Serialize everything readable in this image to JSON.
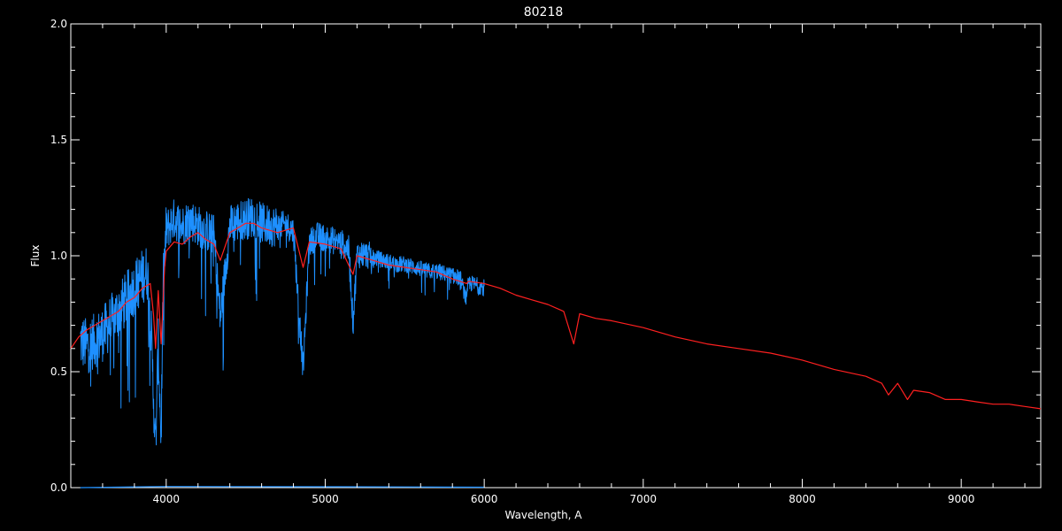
{
  "chart_data": {
    "type": "line",
    "title": "80218",
    "xlabel": "Wavelength, A",
    "ylabel": "Flux",
    "xlim": [
      3400,
      9500
    ],
    "ylim": [
      0.0,
      2.0
    ],
    "x_ticks": [
      4000,
      5000,
      6000,
      7000,
      8000,
      9000
    ],
    "x_tick_labels": [
      "4000",
      "5000",
      "6000",
      "7000",
      "8000",
      "9000"
    ],
    "y_ticks": [
      0.0,
      0.5,
      1.0,
      1.5,
      2.0
    ],
    "y_tick_labels": [
      "0.0",
      "0.5",
      "1.0",
      "1.5",
      "2.0"
    ],
    "grid": false,
    "background": "#000000",
    "axis_color": "#ffffff",
    "series": [
      {
        "color": "#1e90ff",
        "style": "noisy-spectrum",
        "x": [
          3460,
          3500,
          3550,
          3600,
          3650,
          3700,
          3750,
          3800,
          3850,
          3880,
          3900,
          3933,
          3950,
          3968,
          3980,
          4000,
          4050,
          4101,
          4150,
          4200,
          4250,
          4300,
          4340,
          4400,
          4450,
          4500,
          4550,
          4600,
          4650,
          4700,
          4750,
          4800,
          4861,
          4900,
          4950,
          5000,
          5050,
          5100,
          5150,
          5175,
          5200,
          5250,
          5300,
          5350,
          5400,
          5450,
          5500,
          5550,
          5600,
          5650,
          5700,
          5750,
          5800,
          5850,
          5890,
          5900,
          5950,
          6000
        ],
        "y": [
          0.62,
          0.6,
          0.62,
          0.65,
          0.7,
          0.75,
          0.8,
          0.85,
          0.9,
          0.92,
          0.75,
          0.15,
          0.6,
          0.2,
          0.85,
          1.1,
          1.15,
          1.12,
          1.15,
          1.12,
          1.1,
          1.08,
          0.72,
          1.12,
          1.14,
          1.15,
          1.16,
          1.13,
          1.12,
          1.12,
          1.13,
          1.1,
          0.5,
          1.05,
          1.08,
          1.07,
          1.06,
          1.05,
          1.02,
          0.7,
          1.0,
          1.0,
          0.99,
          0.98,
          0.97,
          0.96,
          0.96,
          0.95,
          0.94,
          0.93,
          0.93,
          0.92,
          0.91,
          0.9,
          0.8,
          0.88,
          0.87,
          0.86
        ]
      },
      {
        "color": "#ff2020",
        "style": "model-line",
        "x": [
          3400,
          3450,
          3500,
          3550,
          3600,
          3650,
          3700,
          3750,
          3800,
          3850,
          3900,
          3920,
          3933,
          3950,
          3968,
          3990,
          4000,
          4050,
          4101,
          4150,
          4200,
          4250,
          4300,
          4340,
          4400,
          4450,
          4500,
          4550,
          4600,
          4700,
          4800,
          4861,
          4900,
          5000,
          5100,
          5175,
          5200,
          5300,
          5400,
          5500,
          5600,
          5700,
          5800,
          5890,
          5900,
          6000,
          6100,
          6200,
          6300,
          6400,
          6500,
          6563,
          6600,
          6700,
          6800,
          7000,
          7200,
          7400,
          7600,
          7800,
          8000,
          8200,
          8400,
          8500,
          8542,
          8600,
          8662,
          8700,
          8800,
          8900,
          9000,
          9100,
          9200,
          9300,
          9400,
          9500
        ],
        "y": [
          0.6,
          0.65,
          0.68,
          0.7,
          0.72,
          0.74,
          0.76,
          0.8,
          0.82,
          0.86,
          0.88,
          0.75,
          0.6,
          0.85,
          0.62,
          0.95,
          1.02,
          1.06,
          1.05,
          1.08,
          1.1,
          1.07,
          1.05,
          0.98,
          1.1,
          1.12,
          1.14,
          1.14,
          1.12,
          1.1,
          1.12,
          0.95,
          1.06,
          1.05,
          1.03,
          0.92,
          1.0,
          0.98,
          0.96,
          0.95,
          0.94,
          0.93,
          0.9,
          0.88,
          0.89,
          0.88,
          0.86,
          0.83,
          0.81,
          0.79,
          0.76,
          0.62,
          0.75,
          0.73,
          0.72,
          0.69,
          0.65,
          0.62,
          0.6,
          0.58,
          0.55,
          0.51,
          0.48,
          0.45,
          0.4,
          0.45,
          0.38,
          0.42,
          0.41,
          0.38,
          0.38,
          0.37,
          0.36,
          0.36,
          0.35,
          0.34
        ]
      },
      {
        "color": "#1e90ff",
        "style": "error-spectrum",
        "x": [
          3460,
          4000,
          5000,
          5500,
          6000
        ],
        "y": [
          0.0,
          0.005,
          0.004,
          0.003,
          0.002
        ]
      }
    ]
  }
}
